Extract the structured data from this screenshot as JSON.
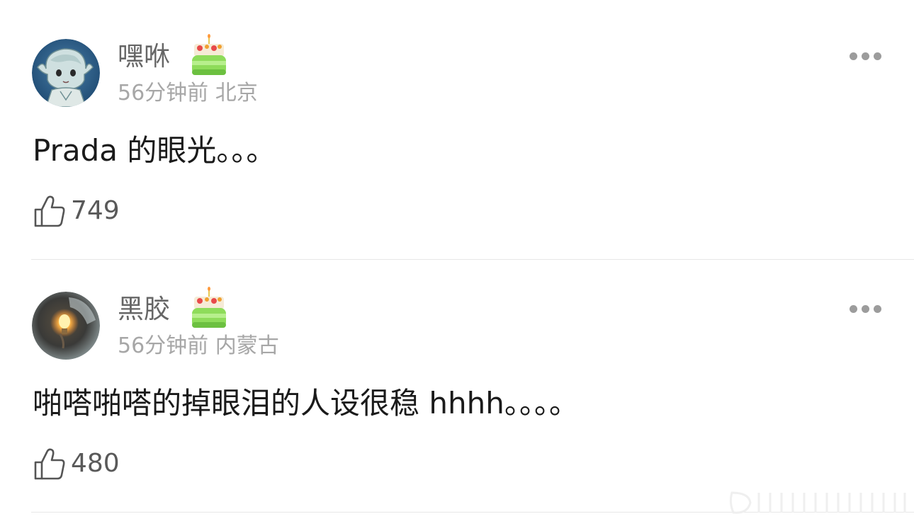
{
  "comments": [
    {
      "username": "嘿咻",
      "time": "56分钟前",
      "location": "北京",
      "text": "Prada 的眼光。。。",
      "likes": "749",
      "avatar_icon": "anime-avatar-icon",
      "badge_icon": "birthday-cake-icon"
    },
    {
      "username": "黑胶",
      "time": "56分钟前",
      "location": "内蒙古",
      "text": "啪嗒啪嗒的掉眼泪的人设很稳 hhhh。。。。",
      "likes": "480",
      "avatar_icon": "lightbulb-avatar-icon",
      "badge_icon": "birthday-cake-icon"
    }
  ],
  "icons": {
    "like": "thumbs-up-icon",
    "more": "more-dots-icon"
  },
  "colors": {
    "username": "#666666",
    "meta": "#a7a7a7",
    "text": "#1a1a1a",
    "divider": "#e7e7e7"
  }
}
